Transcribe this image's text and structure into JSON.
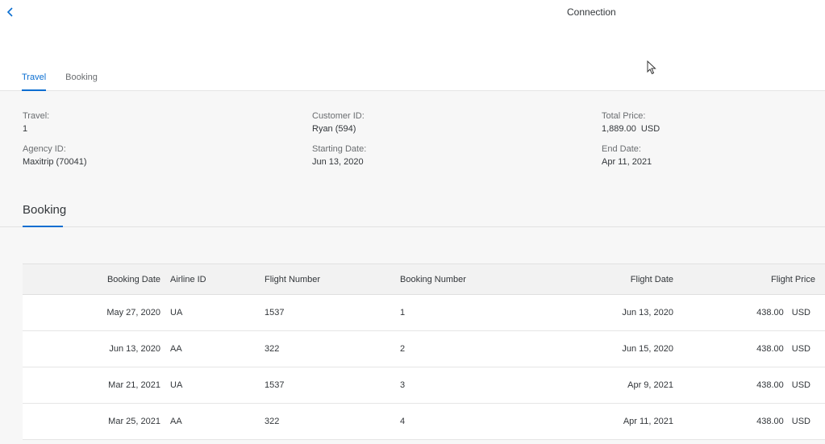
{
  "header": {
    "title": "Connection",
    "tabs": [
      {
        "label": "Travel",
        "active": true
      },
      {
        "label": "Booking",
        "active": false
      }
    ]
  },
  "details": {
    "travel": {
      "label": "Travel:",
      "value": "1"
    },
    "agency": {
      "label": "Agency ID:",
      "value": "Maxitrip (70041)"
    },
    "customer": {
      "label": "Customer ID:",
      "value": "Ryan (594)"
    },
    "starting_date": {
      "label": "Starting Date:",
      "value": "Jun 13, 2020"
    },
    "total_price": {
      "label": "Total Price:",
      "value": "1,889.00  USD"
    },
    "end_date": {
      "label": "End Date:",
      "value": "Apr 11, 2021"
    }
  },
  "booking_section": {
    "title": "Booking",
    "columns": {
      "booking_date": "Booking Date",
      "airline_id": "Airline ID",
      "flight_number": "Flight Number",
      "booking_number": "Booking Number",
      "flight_date": "Flight Date",
      "flight_price": "Flight Price"
    },
    "rows": [
      {
        "booking_date": "May 27, 2020",
        "airline_id": "UA",
        "flight_number": "1537",
        "booking_number": "1",
        "flight_date": "Jun 13, 2020",
        "price": "438.00",
        "currency": "USD"
      },
      {
        "booking_date": "Jun 13, 2020",
        "airline_id": "AA",
        "flight_number": "322",
        "booking_number": "2",
        "flight_date": "Jun 15, 2020",
        "price": "438.00",
        "currency": "USD"
      },
      {
        "booking_date": "Mar 21, 2021",
        "airline_id": "UA",
        "flight_number": "1537",
        "booking_number": "3",
        "flight_date": "Apr 9, 2021",
        "price": "438.00",
        "currency": "USD"
      },
      {
        "booking_date": "Mar 25, 2021",
        "airline_id": "AA",
        "flight_number": "322",
        "booking_number": "4",
        "flight_date": "Apr 11, 2021",
        "price": "438.00",
        "currency": "USD"
      }
    ]
  },
  "icons": {
    "back": "chevron-left-icon",
    "cursor": "mouse-pointer-icon"
  },
  "colors": {
    "accent": "#0a6ed1",
    "text": "#32363a",
    "label": "#6a6d70"
  }
}
